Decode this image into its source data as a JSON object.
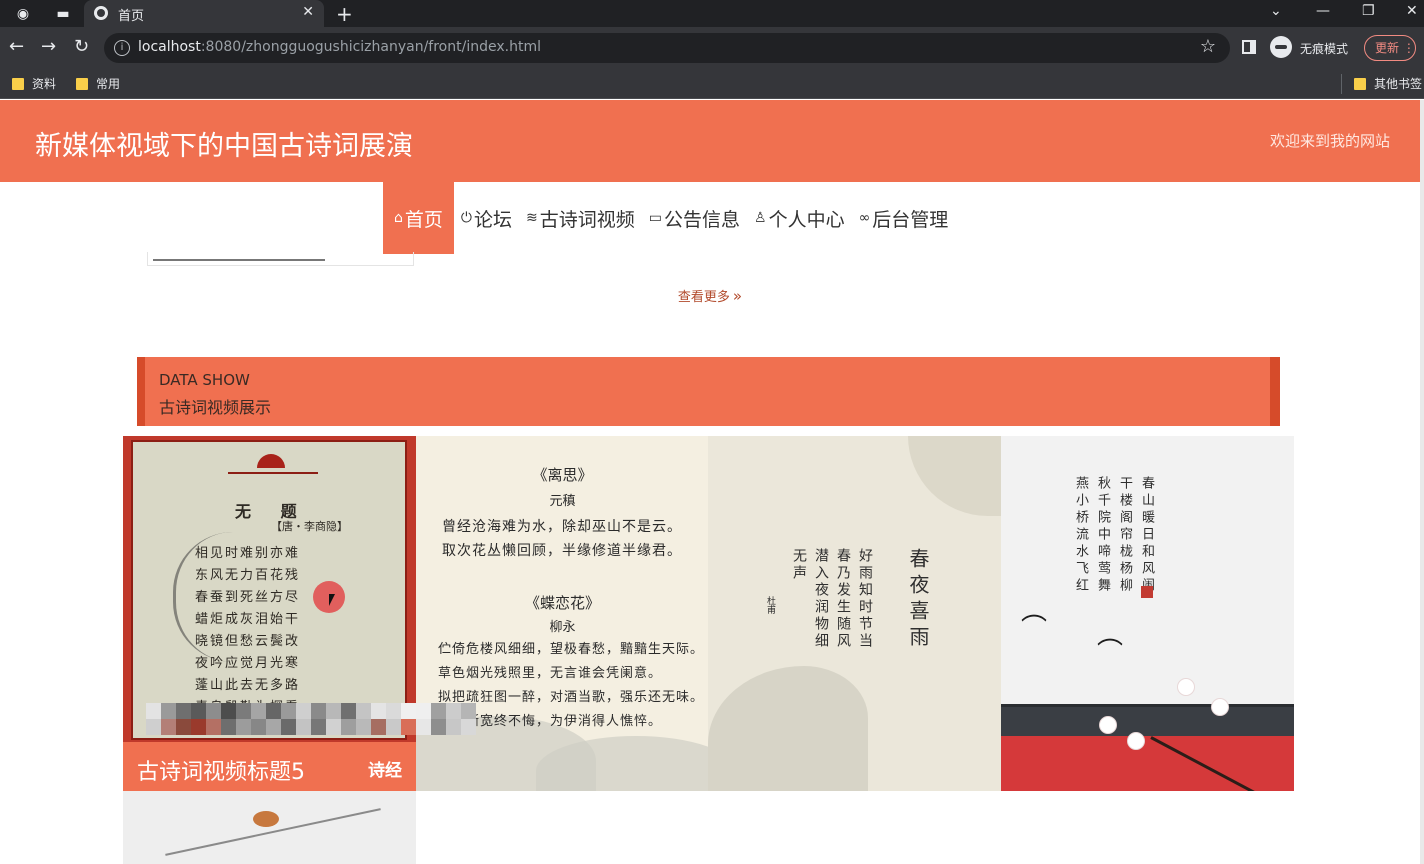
{
  "browser": {
    "tab_title": "首页",
    "url_host": "localhost",
    "url_rest": ":8080/zhongguogushicizhanyan/front/index.html",
    "incognito_label": "无痕模式",
    "update_label": "更新",
    "bookmarks": [
      "资料",
      "常用"
    ],
    "other_bookmarks": "其他书签"
  },
  "site": {
    "title": "新媒体视域下的中国古诗词展演",
    "welcome": "欢迎来到我的网站",
    "nav": [
      {
        "label": "首页",
        "icon": "home-icon",
        "active": true
      },
      {
        "label": "论坛",
        "icon": "power-icon",
        "active": false
      },
      {
        "label": "古诗词视频",
        "icon": "stack-icon",
        "active": false
      },
      {
        "label": "公告信息",
        "icon": "book-icon",
        "active": false
      },
      {
        "label": "个人中心",
        "icon": "user-icon",
        "active": false
      },
      {
        "label": "后台管理",
        "icon": "link-icon",
        "active": false
      }
    ],
    "more_link": "查看更多",
    "section": {
      "en": "DATA SHOW",
      "cn": "古诗词视频展示"
    },
    "cards": [
      {
        "caption_title": "古诗词视频标题5",
        "caption_tag": "诗经",
        "poem_title": "无 题",
        "poem_author": "【唐・李商隐】",
        "poem_lines": [
          "相见时难别亦难",
          "东风无力百花残",
          "春蚕到死丝方尽",
          "蜡炬成灰泪始干",
          "晓镜但愁云鬓改",
          "夜吟应觉月光寒",
          "蓬山此去无多路",
          "青鸟殷勤为探看"
        ]
      },
      {
        "poem1_title": "《离思》",
        "poem1_author": "元稹",
        "poem1_lines": [
          "曾经沧海难为水，除却巫山不是云。",
          "取次花丛懒回顾，半缘修道半缘君。"
        ],
        "poem2_title": "《蝶恋花》",
        "poem2_author": "柳永",
        "poem2_lines": [
          "伫倚危楼风细细，望极春愁，黯黯生天际。",
          "草色烟光残照里，无言谁会凭阑意。",
          "拟把疏狂图一醉，对酒当歌，强乐还无味。",
          "衣带渐宽终不悔，为伊消得人憔悴。"
        ]
      },
      {
        "poem_title": "春夜喜雨",
        "poem_text": "好雨知时节当春乃发生随风潜入夜润物细无声",
        "signature": "杜甫"
      },
      {
        "poem_text": "春山暖日和风阑干楼阁帘栊杨柳秋千院中啼莺舞燕小桥流水飞红"
      }
    ]
  }
}
